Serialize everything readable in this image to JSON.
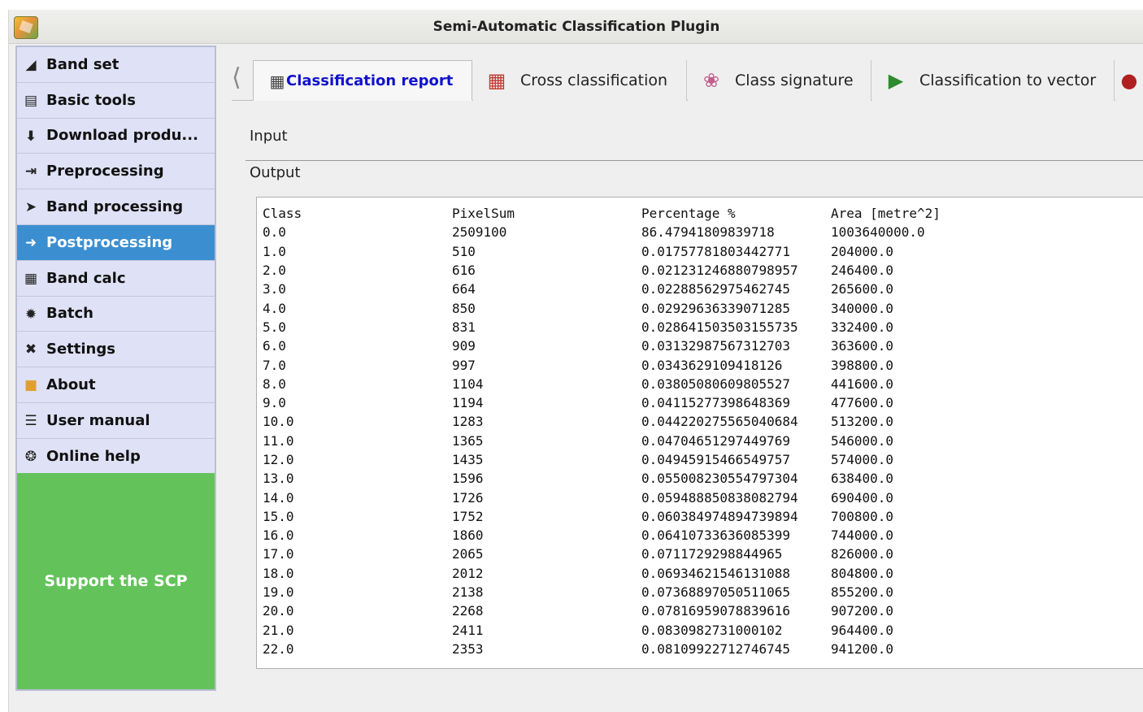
{
  "window": {
    "title": "Semi-Automatic Classification Plugin"
  },
  "sidebar": {
    "items": [
      {
        "label": "Band set",
        "icon": "band-set-icon"
      },
      {
        "label": "Basic tools",
        "icon": "basic-tools-icon"
      },
      {
        "label": "Download produ...",
        "icon": "download-icon"
      },
      {
        "label": "Preprocessing",
        "icon": "preprocessing-icon"
      },
      {
        "label": "Band processing",
        "icon": "band-processing-icon"
      },
      {
        "label": "Postprocessing",
        "icon": "postprocessing-icon",
        "active": true
      },
      {
        "label": "Band calc",
        "icon": "calculator-icon"
      },
      {
        "label": "Batch",
        "icon": "batch-icon"
      },
      {
        "label": "Settings",
        "icon": "settings-icon"
      },
      {
        "label": "About",
        "icon": "about-icon"
      },
      {
        "label": "User manual",
        "icon": "manual-icon"
      },
      {
        "label": "Online help",
        "icon": "help-icon"
      }
    ],
    "support_label": "Support the SCP"
  },
  "tabs": [
    {
      "label": "Classification report",
      "icon": "report-icon",
      "active": true
    },
    {
      "label": "Cross classification",
      "icon": "cross-classification-icon"
    },
    {
      "label": "Class signature",
      "icon": "signature-icon"
    },
    {
      "label": "Classification to vector",
      "icon": "vector-icon"
    }
  ],
  "sections": {
    "input": "Input",
    "output": "Output"
  },
  "report": {
    "headers": [
      "Class",
      "PixelSum",
      "Percentage %",
      "Area [metre^2]"
    ],
    "rows": [
      [
        "0.0",
        "2509100",
        "86.47941809839718",
        "1003640000.0"
      ],
      [
        "1.0",
        "510",
        "0.01757781803442771",
        "204000.0"
      ],
      [
        "2.0",
        "616",
        "0.021231246880798957",
        "246400.0"
      ],
      [
        "3.0",
        "664",
        "0.02288562975462745",
        "265600.0"
      ],
      [
        "4.0",
        "850",
        "0.02929636339071285",
        "340000.0"
      ],
      [
        "5.0",
        "831",
        "0.028641503503155735",
        "332400.0"
      ],
      [
        "6.0",
        "909",
        "0.03132987567312703",
        "363600.0"
      ],
      [
        "7.0",
        "997",
        "0.0343629109418126",
        "398800.0"
      ],
      [
        "8.0",
        "1104",
        "0.03805080609805527",
        "441600.0"
      ],
      [
        "9.0",
        "1194",
        "0.04115277398648369",
        "477600.0"
      ],
      [
        "10.0",
        "1283",
        "0.044220275565040684",
        "513200.0"
      ],
      [
        "11.0",
        "1365",
        "0.04704651297449769",
        "546000.0"
      ],
      [
        "12.0",
        "1435",
        "0.04945915466549757",
        "574000.0"
      ],
      [
        "13.0",
        "1596",
        "0.055008230554797304",
        "638400.0"
      ],
      [
        "14.0",
        "1726",
        "0.059488850838082794",
        "690400.0"
      ],
      [
        "15.0",
        "1752",
        "0.060384974894739894",
        "700800.0"
      ],
      [
        "16.0",
        "1860",
        "0.06410733636085399",
        "744000.0"
      ],
      [
        "17.0",
        "2065",
        "0.0711729298844965",
        "826000.0"
      ],
      [
        "18.0",
        "2012",
        "0.06934621546131088",
        "804800.0"
      ],
      [
        "19.0",
        "2138",
        "0.07368897050511065",
        "855200.0"
      ],
      [
        "20.0",
        "2268",
        "0.07816959078839616",
        "907200.0"
      ],
      [
        "21.0",
        "2411",
        "0.0830982731000102",
        "964400.0"
      ],
      [
        "22.0",
        "2353",
        "0.08109922712746745",
        "941200.0"
      ]
    ]
  },
  "colors": {
    "active_item": "#3b8fd0",
    "support_bg": "#63c35a",
    "active_tab_text": "#1111cc"
  }
}
